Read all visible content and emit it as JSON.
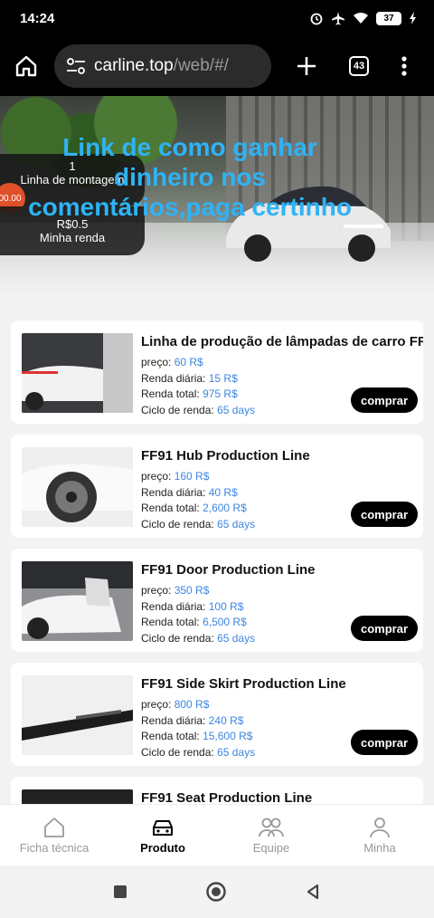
{
  "status": {
    "time": "14:24",
    "battery": "37"
  },
  "browser": {
    "url_host": "carline.top",
    "url_path": "/web/#/",
    "tab_count": "43"
  },
  "hero": {
    "panel_count": "1",
    "panel_line_label": "Linha de montagem",
    "panel_badge": "00.00",
    "panel_income_value": "R$0.5",
    "panel_income_label": "Minha renda"
  },
  "overlay_text": "Link de como ganhar dinheiro nos comentários,paga certinho",
  "labels": {
    "price": "preço:",
    "daily": "Renda diária:",
    "total": "Renda total:",
    "cycle": "Ciclo de renda:",
    "buy": "comprar"
  },
  "products": [
    {
      "title": "Linha de produção de lâmpadas de carro FF91",
      "price": "60 R$",
      "daily": "15 R$",
      "total": "975 R$",
      "cycle": "65 days"
    },
    {
      "title": "FF91 Hub Production Line",
      "price": "160 R$",
      "daily": "40 R$",
      "total": "2,600 R$",
      "cycle": "65 days"
    },
    {
      "title": "FF91 Door Production Line",
      "price": "350 R$",
      "daily": "100 R$",
      "total": "6,500 R$",
      "cycle": "65 days"
    },
    {
      "title": "FF91 Side Skirt Production Line",
      "price": "800 R$",
      "daily": "240 R$",
      "total": "15,600 R$",
      "cycle": "65 days"
    },
    {
      "title": "FF91 Seat Production Line",
      "price": "",
      "daily": "",
      "total": "",
      "cycle": ""
    }
  ],
  "nav": [
    {
      "label": "Ficha técnica",
      "icon": "home-icon"
    },
    {
      "label": "Produto",
      "icon": "car-icon"
    },
    {
      "label": "Equipe",
      "icon": "team-icon"
    },
    {
      "label": "Minha",
      "icon": "user-icon"
    }
  ],
  "colors": {
    "accent_blue": "#3d86e0",
    "overlay_blue": "#2fb3f5",
    "button_black": "#000000"
  }
}
